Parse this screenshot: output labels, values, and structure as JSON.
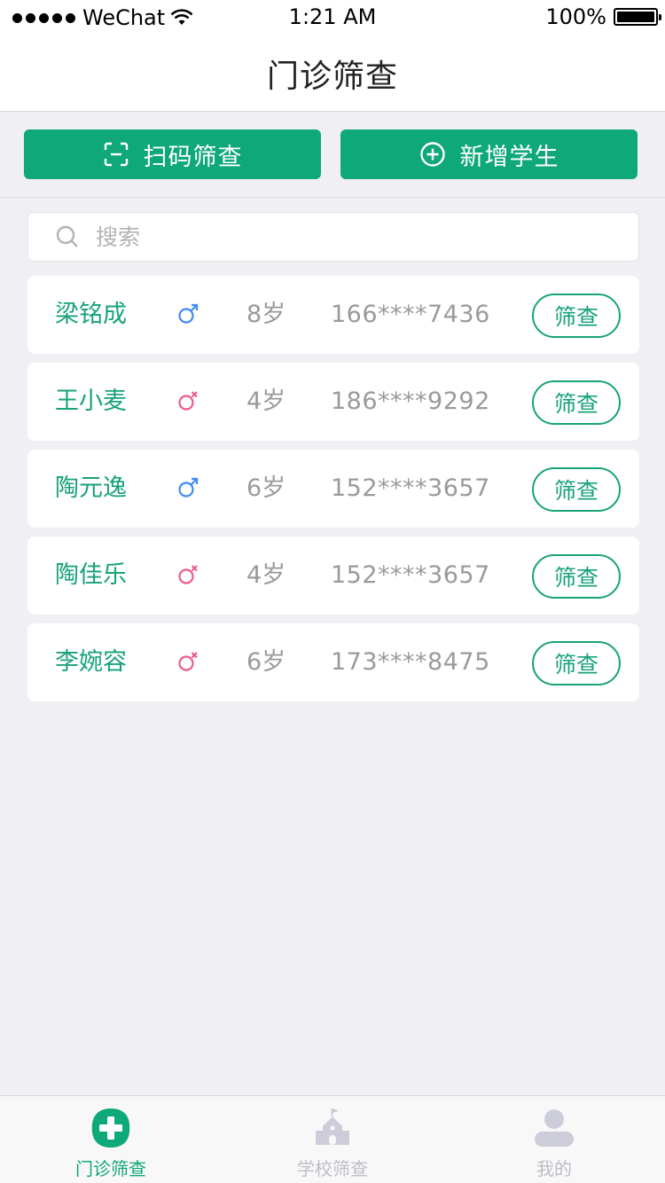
{
  "status_bar": {
    "carrier": "WeChat",
    "time": "1:21 AM",
    "battery": "100%"
  },
  "nav": {
    "title": "门诊筛查"
  },
  "actions": {
    "scan_label": "扫码筛查",
    "add_label": "新增学生"
  },
  "search": {
    "placeholder": "搜索"
  },
  "colors": {
    "accent": "#0fa878",
    "male": "#3d8cf0",
    "female": "#ee5a8a"
  },
  "students": [
    {
      "name": "梁铭成",
      "gender": "male",
      "age": "8岁",
      "phone": "166****7436",
      "action": "筛查"
    },
    {
      "name": "王小麦",
      "gender": "female",
      "age": "4岁",
      "phone": "186****9292",
      "action": "筛查"
    },
    {
      "name": "陶元逸",
      "gender": "male",
      "age": "6岁",
      "phone": "152****3657",
      "action": "筛查"
    },
    {
      "name": "陶佳乐",
      "gender": "female",
      "age": "4岁",
      "phone": "152****3657",
      "action": "筛查"
    },
    {
      "name": "李婉容",
      "gender": "female",
      "age": "6岁",
      "phone": "173****8475",
      "action": "筛查"
    }
  ],
  "tabs": [
    {
      "label": "门诊筛查",
      "icon": "medical-cross-icon",
      "active": true
    },
    {
      "label": "学校筛查",
      "icon": "school-icon",
      "active": false
    },
    {
      "label": "我的",
      "icon": "user-icon",
      "active": false
    }
  ]
}
